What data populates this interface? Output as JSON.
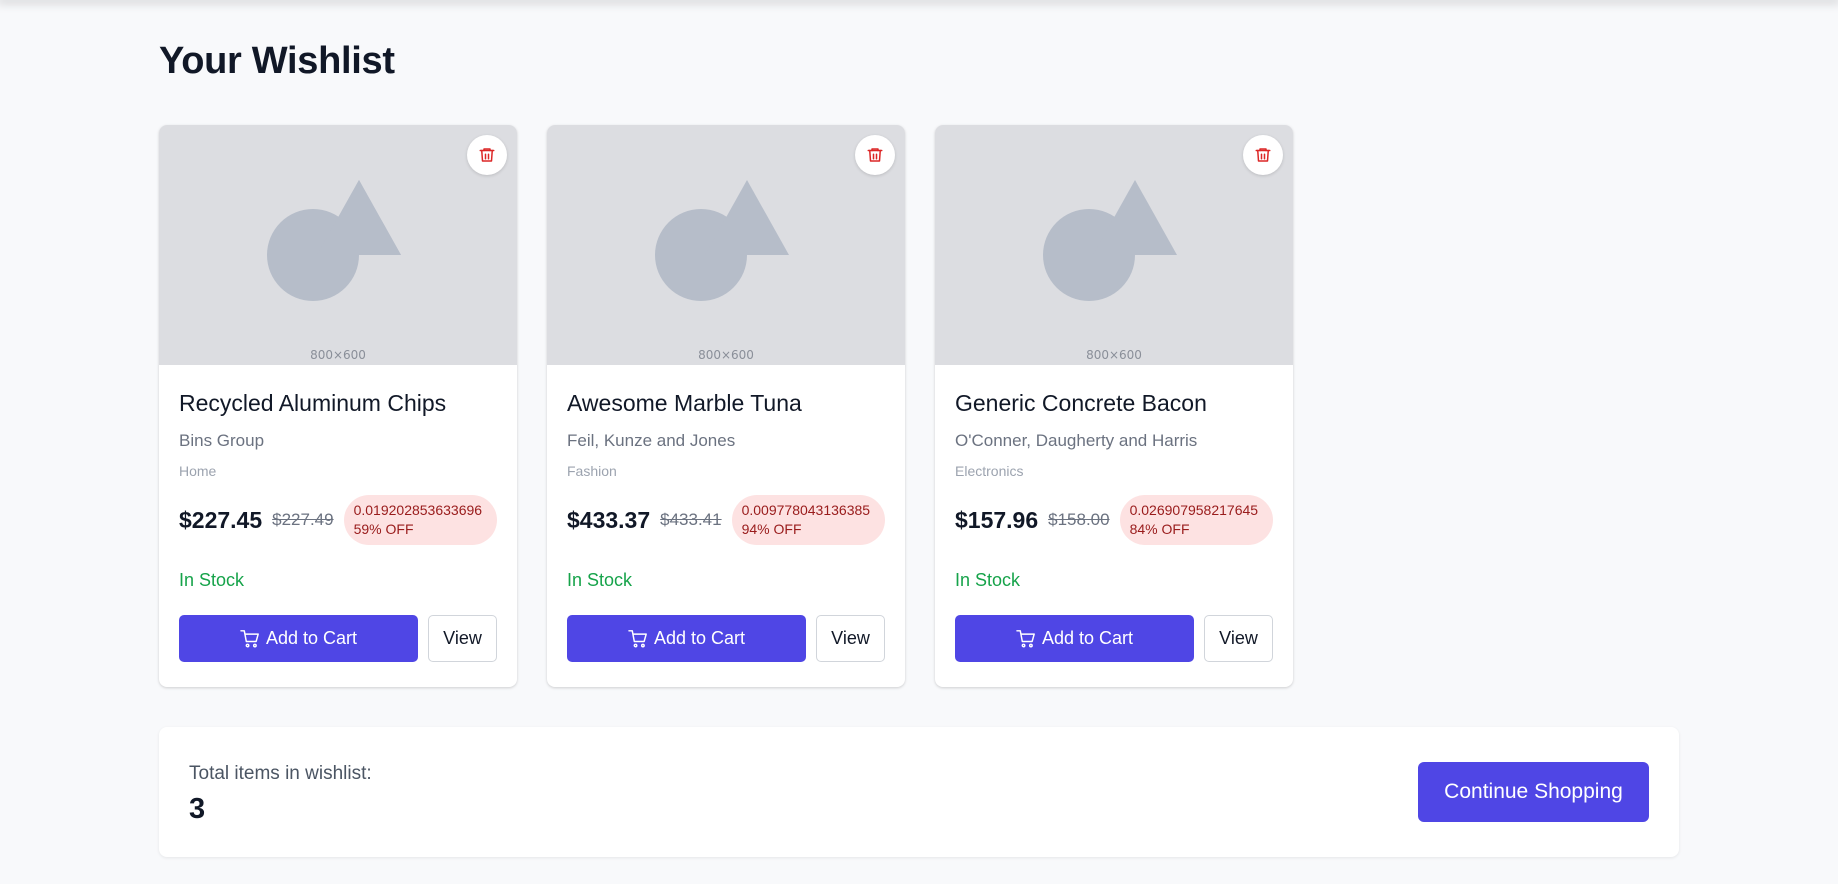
{
  "page": {
    "title": "Your Wishlist"
  },
  "colors": {
    "accent": "#4f46e5",
    "in_stock": "#16a34a",
    "discount_bg": "#fde2e2",
    "discount_text": "#991b1b",
    "remove_icon": "#dc2626"
  },
  "items": [
    {
      "image_label": "800×600",
      "name": "Recycled Aluminum Chips",
      "brand": "Bins Group",
      "category": "Home",
      "price": "$227.45",
      "original_price": "$227.49",
      "discount": "0.01920285363369659% OFF",
      "stock": "In Stock",
      "add_label": "Add to Cart",
      "view_label": "View",
      "remove_icon": "trash-icon"
    },
    {
      "image_label": "800×600",
      "name": "Awesome Marble Tuna",
      "brand": "Feil, Kunze and Jones",
      "category": "Fashion",
      "price": "$433.37",
      "original_price": "$433.41",
      "discount": "0.00977804313638594% OFF",
      "stock": "In Stock",
      "add_label": "Add to Cart",
      "view_label": "View",
      "remove_icon": "trash-icon"
    },
    {
      "image_label": "800×600",
      "name": "Generic Concrete Bacon",
      "brand": "O'Conner, Daugherty and Harris",
      "category": "Electronics",
      "price": "$157.96",
      "original_price": "$158.00",
      "discount": "0.02690795821764584% OFF",
      "stock": "In Stock",
      "add_label": "Add to Cart",
      "view_label": "View",
      "remove_icon": "trash-icon"
    }
  ],
  "summary": {
    "label": "Total items in wishlist:",
    "count": "3",
    "continue_label": "Continue Shopping"
  }
}
